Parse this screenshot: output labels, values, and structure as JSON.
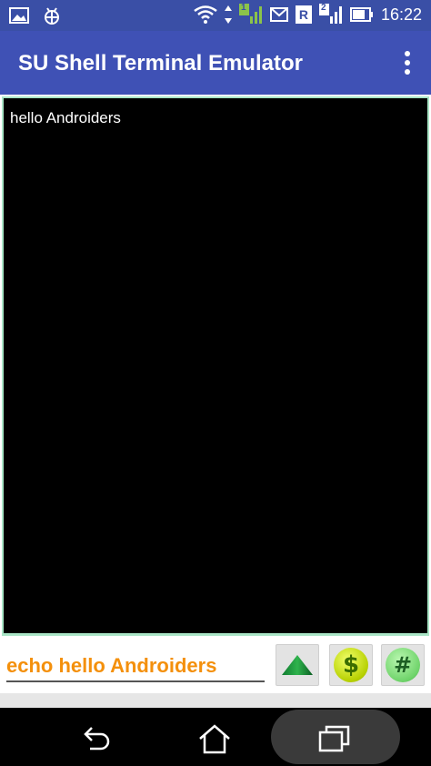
{
  "status_bar": {
    "time": "16:22",
    "sim_badge_1": "1",
    "sim_badge_2": "2",
    "roaming_letter": "R"
  },
  "app_bar": {
    "title": "SU Shell Terminal Emulator",
    "more_icon": "more-vert-icon"
  },
  "terminal": {
    "output_lines": [
      "hello Androiders"
    ]
  },
  "input": {
    "command_value": "echo hello Androiders"
  },
  "buttons": {
    "up_icon": "up-arrow-icon",
    "dollar_label": "$",
    "hash_label": "#"
  },
  "nav": {
    "back_icon": "back-icon",
    "home_icon": "home-icon",
    "recents_icon": "recents-icon"
  },
  "colors": {
    "app_bar": "#3f51b5",
    "status_bar": "#3a4fa6",
    "terminal_bg": "#000000",
    "terminal_border": "#a9e5c6",
    "command_text": "#f4900c"
  }
}
